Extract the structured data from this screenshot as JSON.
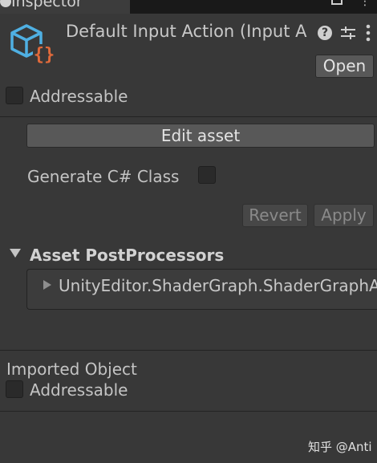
{
  "tab": {
    "label": "Inspector"
  },
  "header": {
    "title": "Default Input Action (Input A",
    "open_label": "Open",
    "help_glyph": "?"
  },
  "addressable": {
    "label": "Addressable",
    "checked": false
  },
  "actions": {
    "edit_label": "Edit asset",
    "generate_label": "Generate C# Class",
    "generate_checked": false,
    "revert_label": "Revert",
    "apply_label": "Apply"
  },
  "postprocessors": {
    "heading": "Asset PostProcessors",
    "items": [
      "UnityEditor.ShaderGraph.ShaderGraphAs"
    ]
  },
  "imported": {
    "heading": "Imported Object",
    "addressable_label": "Addressable",
    "checked": false
  },
  "watermark": "知乎 @Anti",
  "colors": {
    "background": "#383838",
    "icon_blue": "#4fb0e3",
    "icon_orange": "#e06a3b",
    "button": "#585858"
  },
  "icons": [
    "info-icon",
    "lock-icon",
    "more-icon",
    "input-actions-asset-icon",
    "help-icon",
    "presets-icon",
    "menu-icon",
    "foldout-arrow-icon"
  ]
}
